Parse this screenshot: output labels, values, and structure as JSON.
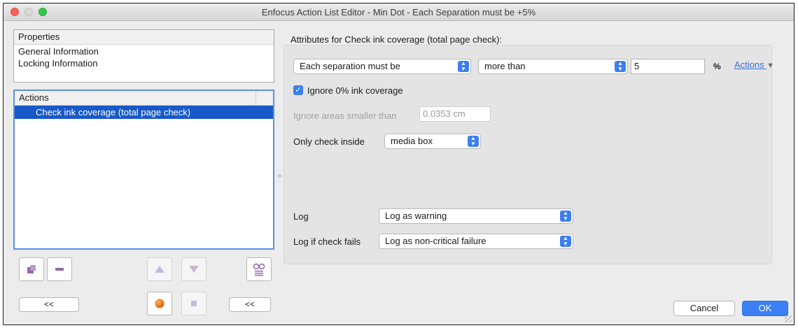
{
  "window": {
    "title": "Enfocus Action List Editor - Min Dot - Each Separation must be +5%"
  },
  "properties": {
    "header": "Properties",
    "items": [
      "General Information",
      "Locking Information"
    ]
  },
  "actions": {
    "header": "Actions",
    "items": [
      "Check ink coverage (total page check)"
    ]
  },
  "left_buttons": {
    "collapse_left": "<<",
    "collapse_right": "<<"
  },
  "attributes": {
    "heading": "Attributes for Check ink coverage (total page check):",
    "separation_select": "Each separation must be",
    "comparison_select": "more than",
    "value": "5",
    "unit": "%",
    "actions_link": "Actions",
    "ignore_zero_label": "Ignore 0% ink coverage",
    "ignore_areas_label": "Ignore areas smaller than",
    "ignore_areas_value": "0.0353 cm",
    "only_check_label": "Only check inside",
    "only_check_select": "media box",
    "log_label": "Log",
    "log_select": "Log as warning",
    "log_fail_label": "Log if check fails",
    "log_fail_select": "Log as non-critical failure"
  },
  "footer": {
    "cancel": "Cancel",
    "ok": "OK"
  },
  "colors": {
    "accent": "#3d80f5",
    "selection": "#1759c8",
    "record": "#f07a12"
  }
}
